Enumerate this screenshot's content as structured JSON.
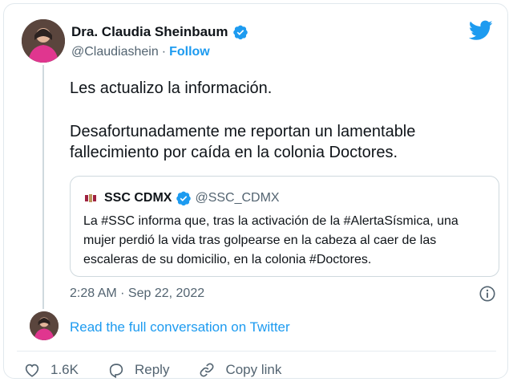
{
  "author": {
    "name": "Dra. Claudia Sheinbaum",
    "handle": "@Claudiashein",
    "separator": "·",
    "follow_label": "Follow"
  },
  "tweet": {
    "paragraphs": [
      "Les actualizo la información.",
      "Desafortunadamente me reportan un lamentable fallecimiento por caída en la colonia Doctores."
    ],
    "timestamp": "2:28 AM · Sep 22, 2022"
  },
  "quote": {
    "name": "SSC CDMX",
    "handle": "@SSC_CDMX",
    "text": "La #SSC informa que, tras la activación de la #AlertaSísmica, una mujer perdió la vida tras golpearse en la cabeza al caer de las escaleras de su domicilio, en la colonia #Doctores."
  },
  "read_more": "Read the full conversation on Twitter",
  "actions": {
    "like_count": "1.6K",
    "reply_label": "Reply",
    "copy_label": "Copy link"
  },
  "colors": {
    "accent": "#1d9bf0",
    "text": "#0f1419",
    "muted": "#536471",
    "border": "#cfd9de"
  },
  "icons": [
    "verified-badge-icon",
    "twitter-bird-icon",
    "info-icon",
    "heart-icon",
    "reply-icon",
    "link-icon"
  ]
}
